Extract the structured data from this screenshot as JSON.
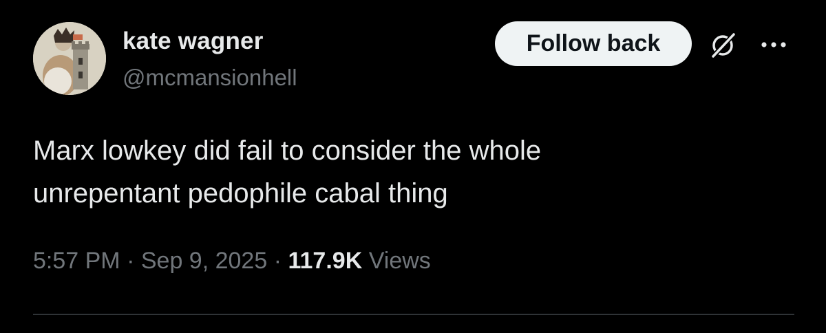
{
  "author": {
    "display_name": "kate wagner",
    "handle": "@mcmansionhell",
    "avatar_icon": "castle-figurine-avatar"
  },
  "actions": {
    "follow_label": "Follow back",
    "grok_icon": "grok-icon",
    "more_icon": "more-options-icon"
  },
  "tweet": {
    "lines": [
      "Marx lowkey did fail to consider the whole",
      "unrepentant pedophile cabal thing"
    ]
  },
  "meta": {
    "time": "5:57 PM",
    "separator": "·",
    "date": "Sep 9, 2025",
    "views_count": "117.9K",
    "views_label": "Views"
  },
  "colors": {
    "background": "#000000",
    "primary_text": "#e7e9ea",
    "secondary_text": "#71767b",
    "button_bg": "#eff3f4",
    "divider": "#2f3336"
  }
}
